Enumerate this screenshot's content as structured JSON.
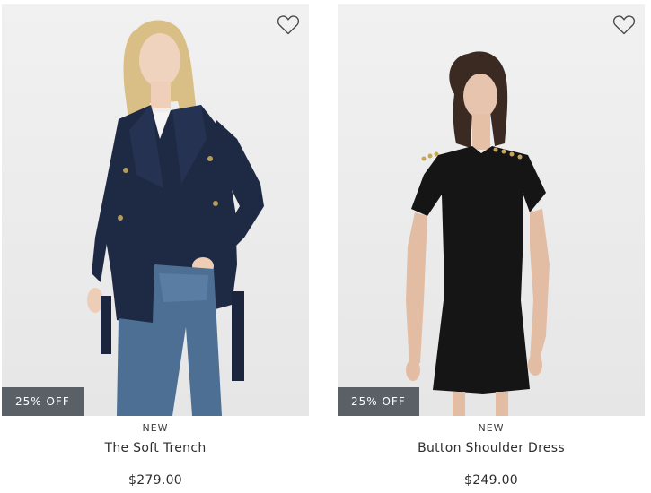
{
  "products": [
    {
      "tag": "NEW",
      "name": "The Soft Trench",
      "price": "$279.00",
      "badge": "25% OFF",
      "wishlist_icon": "heart-outline-icon"
    },
    {
      "tag": "NEW",
      "name": "Button Shoulder Dress",
      "price": "$249.00",
      "badge": "25% OFF",
      "wishlist_icon": "heart-outline-icon"
    }
  ],
  "colors": {
    "badge_bg": "#5b5f66",
    "text": "#2e2e2e",
    "image_bg": "#ececec"
  }
}
